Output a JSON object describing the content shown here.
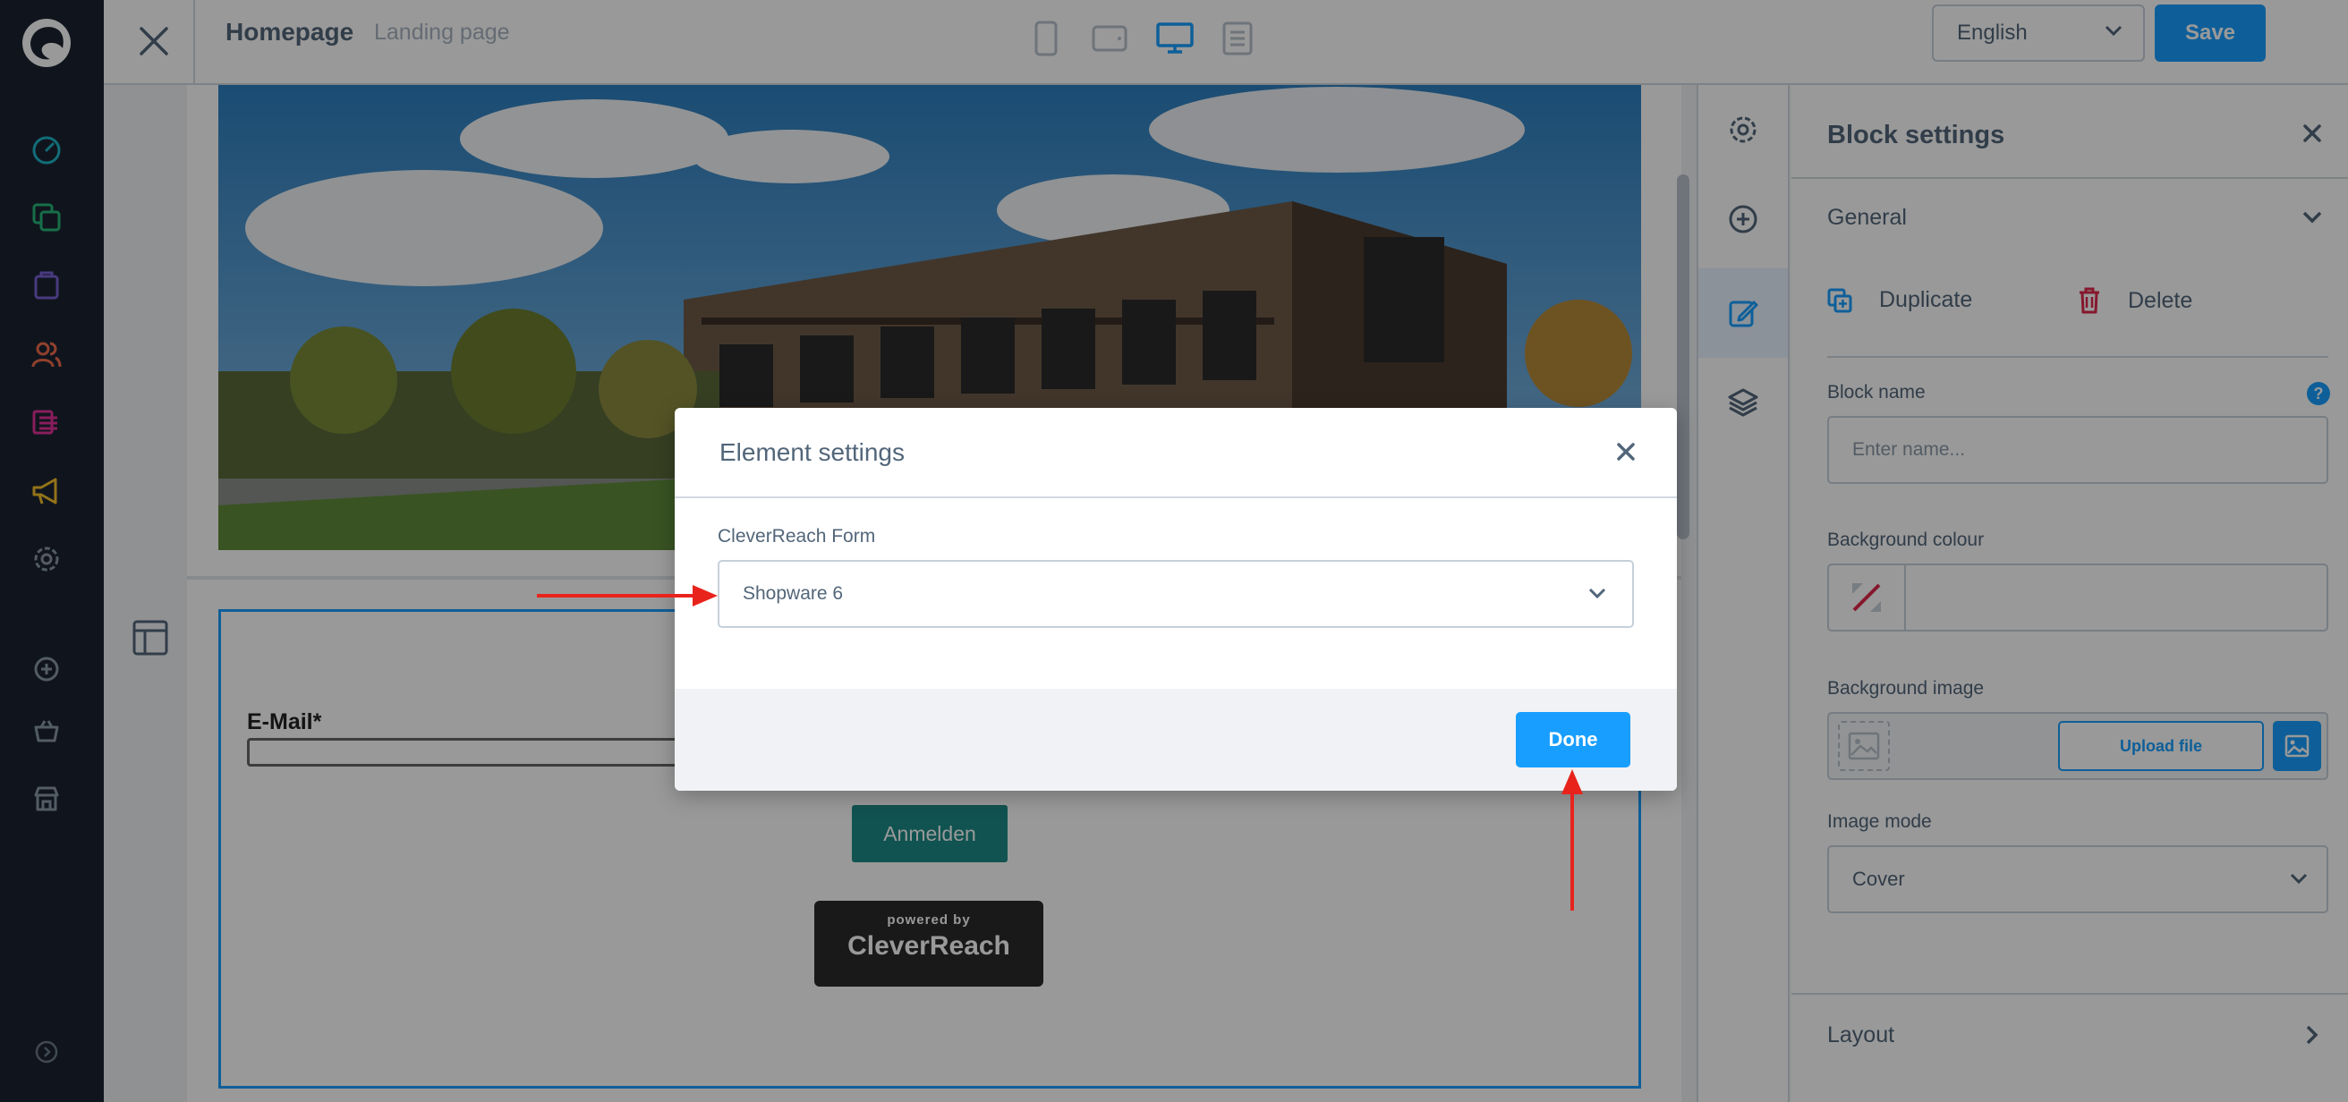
{
  "header": {
    "page_title": "Homepage",
    "page_type": "Landing page",
    "language": "English",
    "save_label": "Save"
  },
  "viewports": [
    "mobile-icon",
    "tablet-icon",
    "desktop-icon",
    "list-icon"
  ],
  "canvas": {
    "email_label": "E-Mail*",
    "submit_label": "Anmelden",
    "badge_small": "powered by",
    "badge_brand": "CleverReach"
  },
  "block_settings": {
    "title": "Block settings",
    "general": "General",
    "duplicate": "Duplicate",
    "delete": "Delete",
    "block_name_label": "Block name",
    "block_name_placeholder": "Enter name...",
    "help": "?",
    "background_colour_label": "Background colour",
    "background_image_label": "Background image",
    "upload_label": "Upload file",
    "image_mode_label": "Image mode",
    "image_mode_value": "Cover",
    "layout": "Layout"
  },
  "modal": {
    "title": "Element settings",
    "field_label": "CleverReach Form",
    "selected": "Shopware 6",
    "done_label": "Done"
  },
  "colors": {
    "accent": "#189eff",
    "sidebar_bg": "#1b2431",
    "annotation": "#e8231c"
  }
}
